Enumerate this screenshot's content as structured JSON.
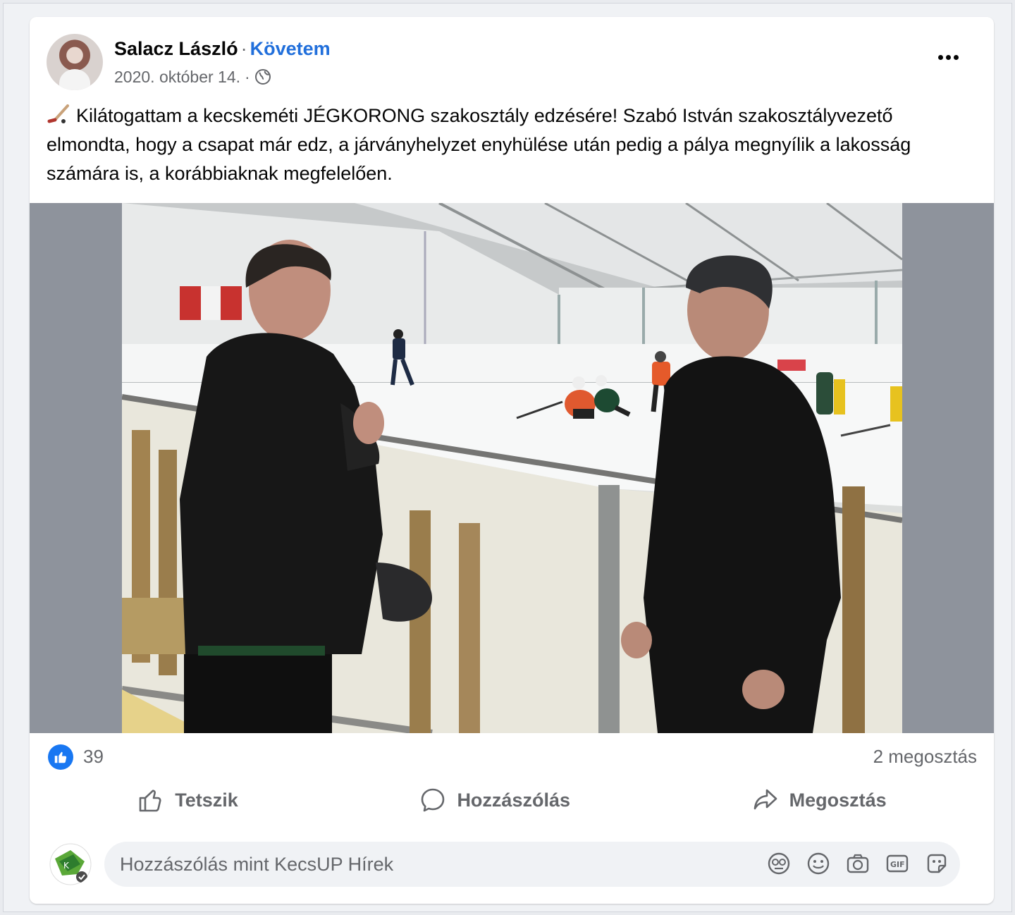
{
  "post": {
    "author": "Salacz László",
    "separator": "·",
    "follow_label": "Követem",
    "date": "2020. október 14.",
    "date_separator": "·",
    "audience_icon": "globe-icon",
    "text": "Kilátogattam a kecskeméti JÉGKORONG szakosztály edzésére! Szabó István szakosztályvezető elmondta, hogy a csapat már edz, a járványhelyzet enyhülése után pedig a pálya megnyílik a lakosság számára is, a korábbiaknak megfelelően.",
    "text_icon": "hockey-stick-icon"
  },
  "stats": {
    "reaction_icon": "like-reaction-icon",
    "reaction_count": "39",
    "shares": "2 megosztás"
  },
  "actions": {
    "like_label": "Tetszik",
    "comment_label": "Hozzászólás",
    "share_label": "Megosztás"
  },
  "comment_box": {
    "placeholder": "Hozzászólás mint KecsUP Hírek",
    "tools": [
      "avatar-sticker-icon",
      "emoji-icon",
      "camera-icon",
      "gif-icon",
      "sticker-icon"
    ]
  },
  "colors": {
    "accent": "#216fdb",
    "like_blue": "#1877f2",
    "muted_text": "#65676b"
  }
}
